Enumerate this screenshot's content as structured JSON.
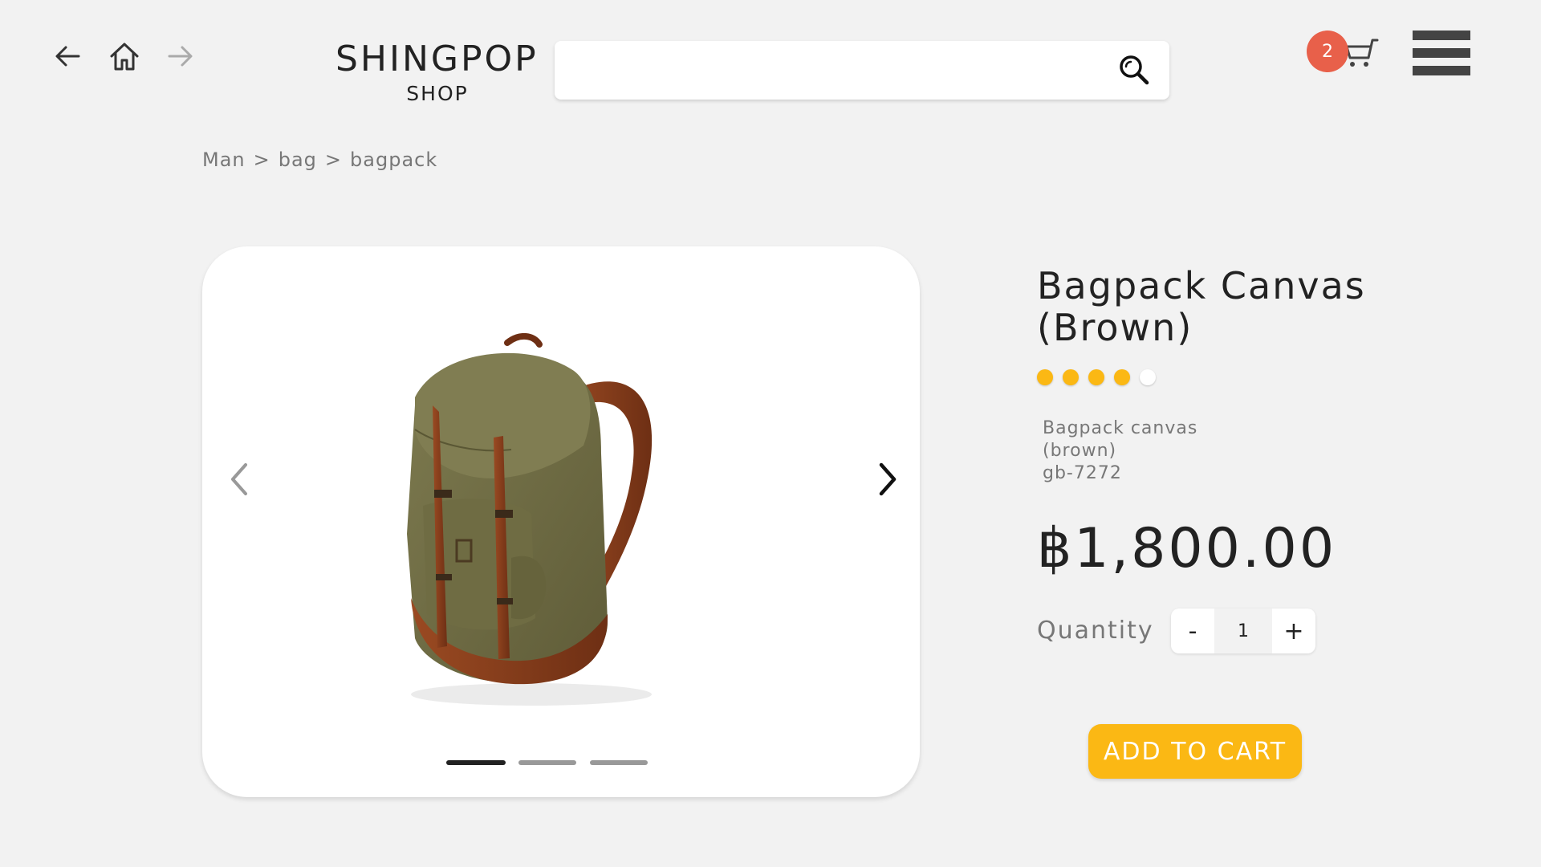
{
  "header": {
    "back_icon": "arrow-left-icon",
    "home_icon": "home-icon",
    "forward_icon": "arrow-right-icon",
    "logo_title": "SHINGPOP",
    "logo_subtitle": "SHOP",
    "search": {
      "value": "",
      "placeholder": "",
      "icon": "search-icon"
    },
    "cart": {
      "count": "2",
      "icon": "cart-icon",
      "badge_color": "#e8604a"
    },
    "menu_icon": "hamburger-menu-icon"
  },
  "breadcrumb": {
    "items": [
      "Man",
      "bag",
      "bagpack"
    ],
    "separator": ">"
  },
  "gallery": {
    "image": "backpack-photo",
    "prev_icon": "chevron-left-icon",
    "next_icon": "chevron-right-icon",
    "active_index": 0,
    "slide_count": 3
  },
  "product": {
    "title_line1": "Bagpack Canvas",
    "title_line2": "(Brown)",
    "rating": 4,
    "rating_max": 5,
    "rating_color": "#fbb814",
    "description_line1": "Bagpack canvas",
    "description_line2": "(brown)",
    "description_line3": "gb-7272",
    "price": "฿1,800.00",
    "quantity_label": "Quantity",
    "quantity_minus": "-",
    "quantity_value": "1",
    "quantity_plus": "+",
    "add_to_cart": "ADD TO CART",
    "accent_color": "#fbb814"
  }
}
